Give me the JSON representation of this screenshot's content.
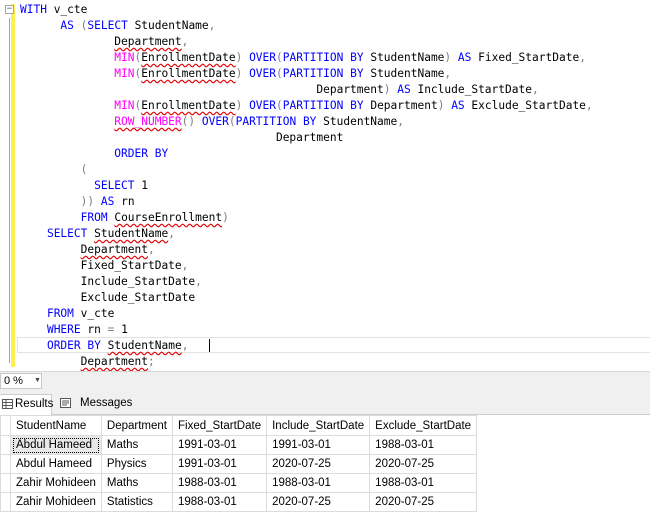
{
  "editor": {
    "lines": [
      [
        {
          "t": "WITH",
          "c": "kw"
        },
        {
          "t": " v_cte",
          "c": "id"
        }
      ],
      [
        {
          "t": "      "
        },
        {
          "t": "AS",
          "c": "kw"
        },
        {
          "t": " ",
          "c": "id"
        },
        {
          "t": "(",
          "c": "op"
        },
        {
          "t": "SELECT",
          "c": "kw"
        },
        {
          "t": " StudentName",
          "c": "id"
        },
        {
          "t": ",",
          "c": "op"
        }
      ],
      [
        {
          "t": "              "
        },
        {
          "t": "Department",
          "c": "id sq"
        },
        {
          "t": ",",
          "c": "op"
        }
      ],
      [
        {
          "t": "              "
        },
        {
          "t": "MIN",
          "c": "fn"
        },
        {
          "t": "(",
          "c": "op"
        },
        {
          "t": "EnrollmentDate",
          "c": "id sq"
        },
        {
          "t": ")",
          "c": "op"
        },
        {
          "t": " ",
          "c": "id"
        },
        {
          "t": "OVER",
          "c": "kw"
        },
        {
          "t": "(",
          "c": "op"
        },
        {
          "t": "PARTITION BY",
          "c": "kw"
        },
        {
          "t": " StudentName",
          "c": "id"
        },
        {
          "t": ")",
          "c": "op"
        },
        {
          "t": " ",
          "c": "id"
        },
        {
          "t": "AS",
          "c": "kw"
        },
        {
          "t": " Fixed_StartDate",
          "c": "id"
        },
        {
          "t": ",",
          "c": "op"
        }
      ],
      [
        {
          "t": "              "
        },
        {
          "t": "MIN",
          "c": "fn"
        },
        {
          "t": "(",
          "c": "op"
        },
        {
          "t": "EnrollmentDate",
          "c": "id sq"
        },
        {
          "t": ")",
          "c": "op"
        },
        {
          "t": " ",
          "c": "id"
        },
        {
          "t": "OVER",
          "c": "kw"
        },
        {
          "t": "(",
          "c": "op"
        },
        {
          "t": "PARTITION BY",
          "c": "kw"
        },
        {
          "t": " StudentName",
          "c": "id"
        },
        {
          "t": ",",
          "c": "op"
        }
      ],
      [
        {
          "t": "                                            "
        },
        {
          "t": "Department",
          "c": "id"
        },
        {
          "t": ")",
          "c": "op"
        },
        {
          "t": " ",
          "c": "id"
        },
        {
          "t": "AS",
          "c": "kw"
        },
        {
          "t": " Include_StartDate",
          "c": "id"
        },
        {
          "t": ",",
          "c": "op"
        }
      ],
      [
        {
          "t": "              "
        },
        {
          "t": "MIN",
          "c": "fn"
        },
        {
          "t": "(",
          "c": "op"
        },
        {
          "t": "EnrollmentDate",
          "c": "id sq"
        },
        {
          "t": ")",
          "c": "op"
        },
        {
          "t": " ",
          "c": "id"
        },
        {
          "t": "OVER",
          "c": "kw"
        },
        {
          "t": "(",
          "c": "op"
        },
        {
          "t": "PARTITION BY",
          "c": "kw"
        },
        {
          "t": " Department",
          "c": "id"
        },
        {
          "t": ")",
          "c": "op"
        },
        {
          "t": " ",
          "c": "id"
        },
        {
          "t": "AS",
          "c": "kw"
        },
        {
          "t": " Exclude_StartDate",
          "c": "id"
        },
        {
          "t": ",",
          "c": "op"
        }
      ],
      [
        {
          "t": "              "
        },
        {
          "t": "ROW_NUMBER",
          "c": "fn sq"
        },
        {
          "t": "()",
          "c": "op"
        },
        {
          "t": " ",
          "c": "id"
        },
        {
          "t": "OVER",
          "c": "kw"
        },
        {
          "t": "(",
          "c": "op"
        },
        {
          "t": "PARTITION BY",
          "c": "kw"
        },
        {
          "t": " StudentName",
          "c": "id"
        },
        {
          "t": ",",
          "c": "op"
        }
      ],
      [
        {
          "t": "                                      "
        },
        {
          "t": "Department",
          "c": "id"
        }
      ],
      [
        {
          "t": "              "
        },
        {
          "t": "ORDER BY",
          "c": "kw"
        }
      ],
      [
        {
          "t": "         "
        },
        {
          "t": "(",
          "c": "op"
        }
      ],
      [
        {
          "t": "           "
        },
        {
          "t": "SELECT",
          "c": "kw"
        },
        {
          "t": " 1",
          "c": "id"
        }
      ],
      [
        {
          "t": "         "
        },
        {
          "t": "))",
          "c": "op"
        },
        {
          "t": " ",
          "c": "id"
        },
        {
          "t": "AS",
          "c": "kw"
        },
        {
          "t": " rn",
          "c": "id"
        }
      ],
      [
        {
          "t": "         "
        },
        {
          "t": "FROM",
          "c": "kw"
        },
        {
          "t": " ",
          "c": "id"
        },
        {
          "t": "CourseEnrollment",
          "c": "id sq"
        },
        {
          "t": ")",
          "c": "op"
        }
      ],
      [
        {
          "t": "    "
        },
        {
          "t": "SELECT",
          "c": "kw"
        },
        {
          "t": " ",
          "c": "id"
        },
        {
          "t": "StudentName",
          "c": "id sq"
        },
        {
          "t": ",",
          "c": "op"
        }
      ],
      [
        {
          "t": "         "
        },
        {
          "t": "Department",
          "c": "id sq"
        },
        {
          "t": ",",
          "c": "op"
        }
      ],
      [
        {
          "t": "         "
        },
        {
          "t": "Fixed_StartDate",
          "c": "id"
        },
        {
          "t": ",",
          "c": "op"
        }
      ],
      [
        {
          "t": "         "
        },
        {
          "t": "Include_StartDate",
          "c": "id"
        },
        {
          "t": ",",
          "c": "op"
        }
      ],
      [
        {
          "t": "         "
        },
        {
          "t": "Exclude_StartDate",
          "c": "id"
        }
      ],
      [
        {
          "t": "    "
        },
        {
          "t": "FROM",
          "c": "kw"
        },
        {
          "t": " v_cte",
          "c": "id"
        }
      ],
      [
        {
          "t": "    "
        },
        {
          "t": "WHERE",
          "c": "kw"
        },
        {
          "t": " rn ",
          "c": "id"
        },
        {
          "t": "=",
          "c": "op"
        },
        {
          "t": " 1",
          "c": "id"
        }
      ],
      [
        {
          "t": "    "
        },
        {
          "t": "ORDER BY",
          "c": "kw"
        },
        {
          "t": " ",
          "c": "id"
        },
        {
          "t": "StudentName",
          "c": "id sq"
        },
        {
          "t": ",",
          "c": "op"
        },
        {
          "t": " ",
          "c": "id"
        }
      ],
      [
        {
          "t": "         "
        },
        {
          "t": "Department",
          "c": "id sq"
        },
        {
          "t": ";",
          "c": "op"
        }
      ]
    ]
  },
  "zoom": {
    "value": "0 %"
  },
  "tabs": {
    "results": "Results",
    "messages": "Messages"
  },
  "grid": {
    "columns": [
      "StudentName",
      "Department",
      "Fixed_StartDate",
      "Include_StartDate",
      "Exclude_StartDate"
    ],
    "rows": [
      [
        "Abdul Hameed",
        "Maths",
        "1991-03-01",
        "1991-03-01",
        "1988-03-01"
      ],
      [
        "Abdul Hameed",
        "Physics",
        "1991-03-01",
        "2020-07-25",
        "2020-07-25"
      ],
      [
        "Zahir Mohideen",
        "Maths",
        "1988-03-01",
        "1988-03-01",
        "1988-03-01"
      ],
      [
        "Zahir Mohideen",
        "Statistics",
        "1988-03-01",
        "2020-07-25",
        "2020-07-25"
      ]
    ]
  }
}
